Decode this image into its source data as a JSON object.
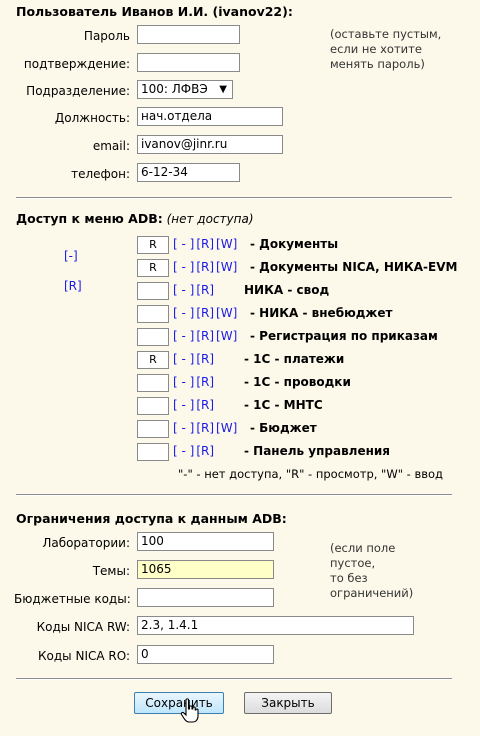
{
  "user": {
    "title": "Пользователь Иванов И.И. (ivanov22):",
    "password_label": "Пароль",
    "password_value": "",
    "confirm_label": "подтверждение:",
    "confirm_value": "",
    "password_note": [
      "(оставьте пустым,",
      "если не хотите",
      "менять пароль)"
    ],
    "department_label": "Подразделение:",
    "department_value": "100: ЛФВЭ",
    "position_label": "Должность:",
    "position_value": "нач.отдела",
    "email_label": "email:",
    "email_value": "ivanov@jinr.ru",
    "phone_label": "телефон:",
    "phone_value": "6-12-34"
  },
  "access": {
    "title": "Доступ к меню ADB:",
    "title_note": "(нет доступа)",
    "none_link": "[-]",
    "read_link": "[R]",
    "rows": [
      {
        "value": "R",
        "links": [
          "[ - ]",
          "[R]",
          "[W]"
        ],
        "name": "- Документы"
      },
      {
        "value": "R",
        "links": [
          "[ - ]",
          "[R]",
          "[W]"
        ],
        "name": "- Документы NICA, НИКА-EVM"
      },
      {
        "value": "",
        "links": [
          "[ - ]",
          "[R]"
        ],
        "name": "НИКА - свод"
      },
      {
        "value": "",
        "links": [
          "[ - ]",
          "[R]",
          "[W]"
        ],
        "name": "- НИКА - внебюджет"
      },
      {
        "value": "",
        "links": [
          "[ - ]",
          "[R]",
          "[W]"
        ],
        "name": "- Регистрация по приказам"
      },
      {
        "value": "R",
        "links": [
          "[ - ]",
          "[R]"
        ],
        "name": "- 1С - платежи"
      },
      {
        "value": "",
        "links": [
          "[ - ]",
          "[R]"
        ],
        "name": "- 1С - проводки"
      },
      {
        "value": "",
        "links": [
          "[ - ]",
          "[R]"
        ],
        "name": "- 1С - МНТС"
      },
      {
        "value": "",
        "links": [
          "[ - ]",
          "[R]",
          "[W]"
        ],
        "name": "- Бюджет"
      },
      {
        "value": "",
        "links": [
          "[ - ]",
          "[R]"
        ],
        "name": "- Панель управления"
      }
    ],
    "legend": "\"-\" - нет доступа, \"R\" - просмотр, \"W\" - ввод"
  },
  "restrictions": {
    "title": "Ограничения доступа к данным ADB:",
    "labs_label": "Лаборатории:",
    "labs_value": "100",
    "topics_label": "Темы:",
    "topics_value": "1065",
    "budget_label": "Бюджетные коды:",
    "budget_value": "",
    "nica_rw_label": "Коды NICA RW:",
    "nica_rw_value": "2.3, 1.4.1",
    "nica_ro_label": "Коды NICA RO:",
    "nica_ro_value": "0",
    "note": [
      "(если поле",
      "пустое,",
      "то без",
      "ограничений)"
    ]
  },
  "buttons": {
    "save_label": "Сохранить",
    "close_label": "Закрыть"
  }
}
